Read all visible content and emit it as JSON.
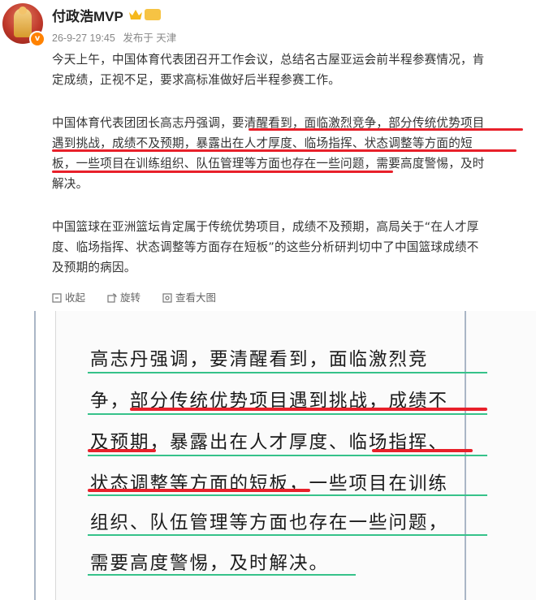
{
  "post": {
    "author": "付政浩MVP",
    "level_badge": "",
    "timestamp": "26-9-27 19:45",
    "source": "发布于 天津",
    "paragraphs": [
      "今天上午，中国体育代表团召开工作会议，总结名古屋亚运会前半程参赛情况，肯定成绩，正视不足，要求高标准做好后半程参赛工作。",
      "中国体育代表团团长高志丹强调，要清醒看到，面临激烈竞争，部分传统优势项目遇到挑战，成绩不及预期，暴露出在人才厚度、临场指挥、状态调整等方面的短板，一些项目在训练组织、队伍管理等方面也存在一些问题，需要高度警惕，及时解决。",
      "中国篮球在亚洲篮坛肯定属于传统优势项目，成绩不及预期，高局关于“在人才厚度、临场指挥、状态调整等方面存在短板”的这些分析研判切中了中国篮球成绩不及预期的病因。"
    ],
    "p1_lines": [
      "今天上午，中国体育代表团召开工作会议，总结名古屋亚运会前半程参赛情况，肯",
      "定成绩，正视不足，要求高标准做好后半程参赛工作。"
    ],
    "p2_lines": [
      "中国体育代表团团长高志丹强调，要清醒看到，面临激烈竞争，部分传统优势项目",
      "遇到挑战，成绩不及预期，暴露出在人才厚度、临场指挥、状态调整等方面的短",
      "板，一些项目在训练组织、队伍管理等方面也存在一些问题，需要高度警惕，及时",
      "解决。"
    ],
    "p3_lines": [
      "中国篮球在亚洲篮坛肯定属于传统优势项目，成绩不及预期，高局关于“在人才厚",
      "度、临场指挥、状态调整等方面存在短板”的这些分析研判切中了中国篮球成绩不",
      "及预期的病因。"
    ]
  },
  "actions": {
    "collect": "收起",
    "rotate": "旋转",
    "view_large": "查看大图"
  },
  "image_text_lines": [
    "高志丹强调，要清醒看到，面临激烈竞",
    "争，部分传统优势项目遇到挑战，成绩不",
    "及预期，暴露出在人才厚度、临场指挥、",
    "状态调整等方面的短板，一些项目在训练",
    "组织、队伍管理等方面也存在一些问题，",
    "需要高度警惕，及时解决。"
  ],
  "colors": {
    "highlight_red": "#e8202a",
    "underline_green": "#36c28a",
    "meta_gray": "#888888",
    "brand_orange": "#ff8200"
  },
  "icons": [
    "verified-v-icon",
    "crown-icon",
    "collapse-icon",
    "rotate-icon",
    "view-large-icon"
  ]
}
